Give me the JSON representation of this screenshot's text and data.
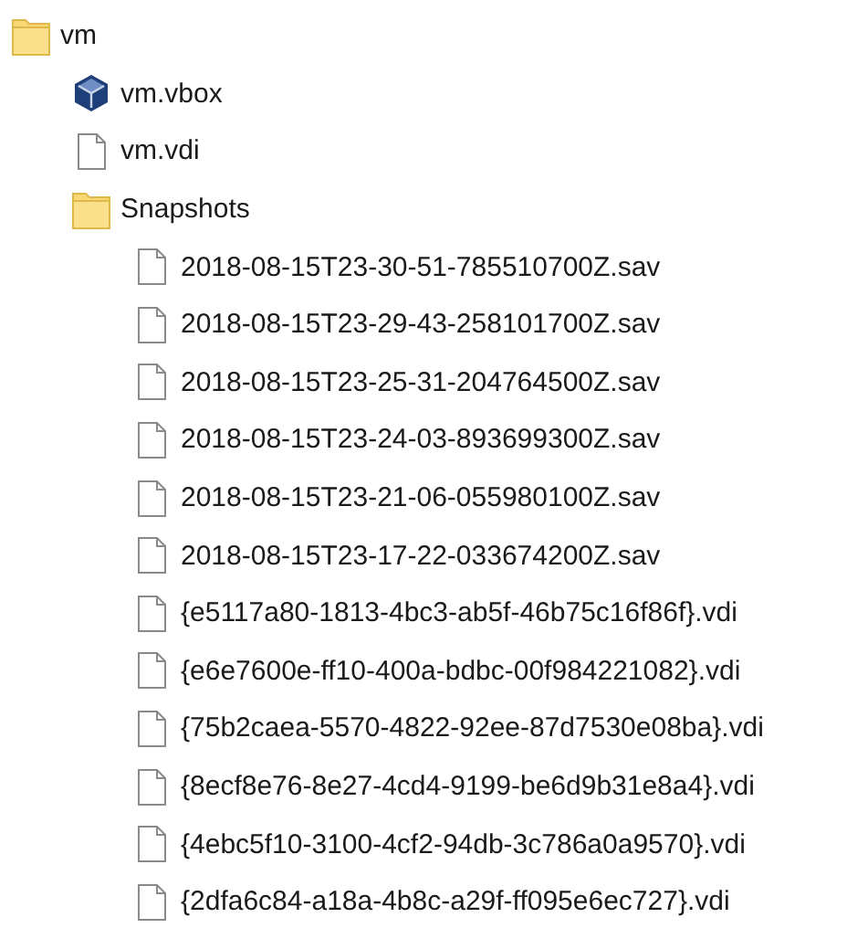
{
  "tree": [
    {
      "name": "vm",
      "kind": "folder",
      "children": [
        {
          "name": "vm.vbox",
          "kind": "vbox"
        },
        {
          "name": "vm.vdi",
          "kind": "file"
        },
        {
          "name": "Snapshots",
          "kind": "folder",
          "children": [
            {
              "name": "2018-08-15T23-30-51-785510700Z.sav",
              "kind": "file"
            },
            {
              "name": "2018-08-15T23-29-43-258101700Z.sav",
              "kind": "file"
            },
            {
              "name": "2018-08-15T23-25-31-204764500Z.sav",
              "kind": "file"
            },
            {
              "name": "2018-08-15T23-24-03-893699300Z.sav",
              "kind": "file"
            },
            {
              "name": "2018-08-15T23-21-06-055980100Z.sav",
              "kind": "file"
            },
            {
              "name": "2018-08-15T23-17-22-033674200Z.sav",
              "kind": "file"
            },
            {
              "name": "{e5117a80-1813-4bc3-ab5f-46b75c16f86f}.vdi",
              "kind": "file"
            },
            {
              "name": "{e6e7600e-ff10-400a-bdbc-00f984221082}.vdi",
              "kind": "file"
            },
            {
              "name": "{75b2caea-5570-4822-92ee-87d7530e08ba}.vdi",
              "kind": "file"
            },
            {
              "name": "{8ecf8e76-8e27-4cd4-9199-be6d9b31e8a4}.vdi",
              "kind": "file"
            },
            {
              "name": "{4ebc5f10-3100-4cf2-94db-3c786a0a9570}.vdi",
              "kind": "file"
            },
            {
              "name": "{2dfa6c84-a18a-4b8c-a29f-ff095e6ec727}.vdi",
              "kind": "file"
            }
          ]
        }
      ]
    }
  ]
}
